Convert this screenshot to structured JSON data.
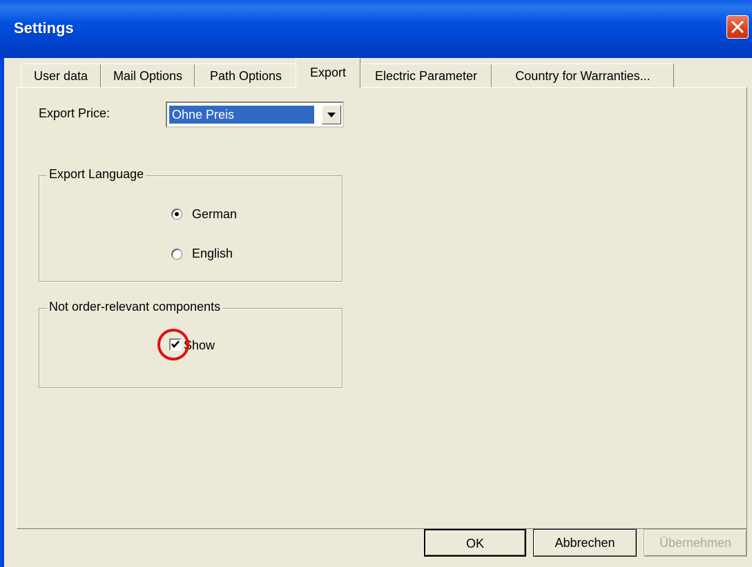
{
  "window": {
    "title": "Settings"
  },
  "tabs": [
    {
      "label": "User data",
      "active": false
    },
    {
      "label": "Mail Options",
      "active": false
    },
    {
      "label": "Path Options",
      "active": false
    },
    {
      "label": "Export",
      "active": true
    },
    {
      "label": "Electric Parameter",
      "active": false
    },
    {
      "label": "Country for Warranties...",
      "active": false
    }
  ],
  "export_price": {
    "label": "Export Price:",
    "selected": "Ohne Preis"
  },
  "export_language": {
    "title": "Export Language",
    "options": [
      {
        "label": "German",
        "checked": true
      },
      {
        "label": "English",
        "checked": false
      }
    ]
  },
  "components": {
    "title": "Not order-relevant components",
    "show_label": "Show",
    "show_checked": true
  },
  "buttons": {
    "ok": "OK",
    "cancel": "Abbrechen",
    "apply": "Übernehmen"
  },
  "colors": {
    "titlebar": "#0050e0",
    "highlight": "#e01010",
    "dialog_bg": "#ece9d8"
  }
}
